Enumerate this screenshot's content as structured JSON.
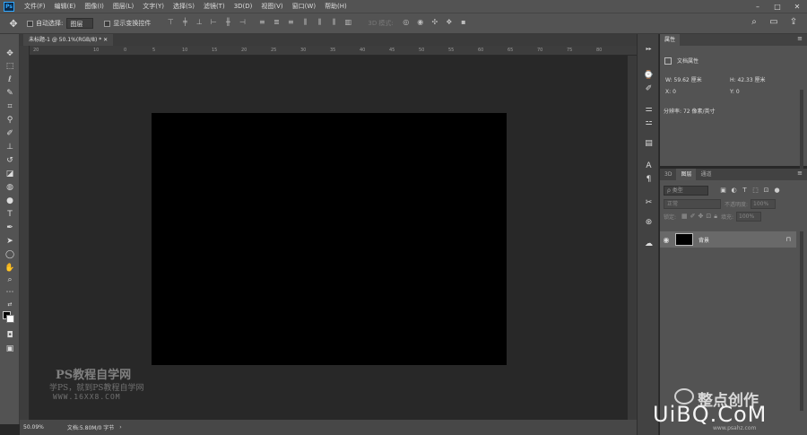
{
  "menubar": {
    "logo": "Ps",
    "items": [
      "文件(F)",
      "编辑(E)",
      "图像(I)",
      "图层(L)",
      "文字(Y)",
      "选择(S)",
      "滤镜(T)",
      "3D(D)",
      "视图(V)",
      "窗口(W)",
      "帮助(H)"
    ],
    "window_controls": [
      "–",
      "□",
      "✕"
    ]
  },
  "options": {
    "auto_select_label": "自动选择:",
    "auto_select_value": "图层",
    "transform_label": "显示变换控件",
    "mode_3d_label": "3D 模式:"
  },
  "document": {
    "tab_title": "未标题-1 @ 50.1%(RGB/8) *",
    "ruler_ticks": [
      "20",
      "10",
      "0",
      "5",
      "10",
      "15",
      "20",
      "25",
      "30",
      "35",
      "40",
      "45",
      "50",
      "55",
      "60",
      "65",
      "70",
      "75",
      "80"
    ],
    "zoom": "50.09%",
    "doc_info": "文档:5.80M/0 字节",
    "status_arrow": "›"
  },
  "properties": {
    "tab_label": "属性",
    "subtitle": "文档属性",
    "width_label": "W:",
    "width_value": "59.62 厘米",
    "height_label": "H:",
    "height_value": "42.33 厘米",
    "x_label": "X:",
    "x_value": "0",
    "y_label": "Y:",
    "y_value": "0",
    "resolution_label": "分辨率:",
    "resolution_value": "72 像素/英寸"
  },
  "layers": {
    "tabs": [
      "3D",
      "图层",
      "通道"
    ],
    "filter_placeholder": "ρ 类型",
    "blend_mode": "正常",
    "opacity_label": "不透明度:",
    "opacity_value": "100%",
    "lock_label": "锁定:",
    "fill_label": "填充:",
    "fill_value": "100%",
    "items": [
      {
        "name": "背景",
        "visible": true,
        "locked": true
      }
    ]
  },
  "watermarks": {
    "line1": "PS教程自学网",
    "line2": "学PS，就到PS教程自学网",
    "line3": "WWW.16XX8.COM",
    "line4": "整点创作",
    "line5": "UiBQ.CoM",
    "line6": "www.psahz.com"
  },
  "colors": {
    "foreground": "#000000",
    "background": "#ffffff",
    "accent": "#31a8ff"
  }
}
